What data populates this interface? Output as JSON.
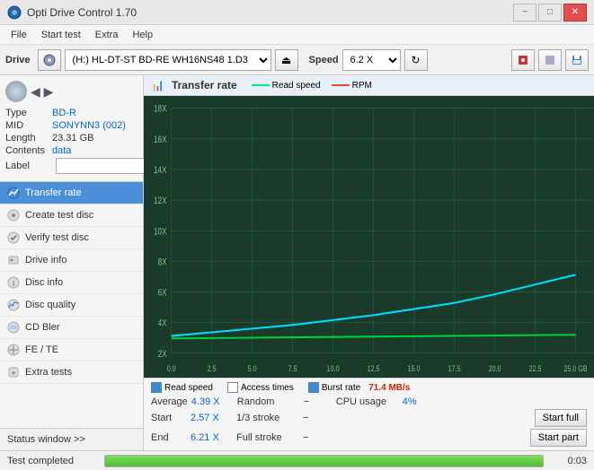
{
  "titleBar": {
    "title": "Opti Drive Control 1.70",
    "minimize": "−",
    "maximize": "□",
    "close": "✕"
  },
  "menu": {
    "items": [
      "File",
      "Start test",
      "Extra",
      "Help"
    ]
  },
  "driveToolbar": {
    "driveLabel": "Drive",
    "driveValue": "(H:)  HL-DT-ST BD-RE  WH16NS48 1.D3",
    "speedLabel": "Speed",
    "speedValue": "6.2 X"
  },
  "disc": {
    "typeLabel": "Type",
    "typeValue": "BD-R",
    "midLabel": "MID",
    "midValue": "SONYNN3 (002)",
    "lengthLabel": "Length",
    "lengthValue": "23.31 GB",
    "contentsLabel": "Contents",
    "contentsValue": "data",
    "labelLabel": "Label",
    "labelValue": ""
  },
  "nav": {
    "items": [
      {
        "id": "transfer-rate",
        "label": "Transfer rate",
        "active": true
      },
      {
        "id": "create-test-disc",
        "label": "Create test disc",
        "active": false
      },
      {
        "id": "verify-test-disc",
        "label": "Verify test disc",
        "active": false
      },
      {
        "id": "drive-info",
        "label": "Drive info",
        "active": false
      },
      {
        "id": "disc-info",
        "label": "Disc info",
        "active": false
      },
      {
        "id": "disc-quality",
        "label": "Disc quality",
        "active": false
      },
      {
        "id": "cd-bler",
        "label": "CD Bler",
        "active": false
      },
      {
        "id": "fe-te",
        "label": "FE / TE",
        "active": false
      },
      {
        "id": "extra-tests",
        "label": "Extra tests",
        "active": false
      }
    ],
    "statusWindow": "Status window >>"
  },
  "chart": {
    "title": "Transfer rate",
    "legend": {
      "readSpeedColor": "#00ee88",
      "rpmColor": "#ee4444",
      "readSpeedLabel": "Read speed",
      "rpmLabel": "RPM"
    },
    "yLabels": [
      "2X",
      "4X",
      "6X",
      "8X",
      "10X",
      "12X",
      "14X",
      "16X",
      "18X"
    ],
    "xLabels": [
      "0.0",
      "2.5",
      "5.0",
      "7.5",
      "10.0",
      "12.5",
      "15.0",
      "17.5",
      "20.0",
      "22.5",
      "25.0 GB"
    ],
    "readSpeedLineColor": "#00ddff",
    "rpmLineColor": "#00cc44"
  },
  "stats": {
    "checkboxes": [
      {
        "label": "Read speed",
        "checked": true
      },
      {
        "label": "Access times",
        "checked": false
      },
      {
        "label": "Burst rate",
        "checked": true
      }
    ],
    "burstRate": "71.4 MB/s",
    "rows": [
      {
        "label": "Average",
        "value": "4.39 X",
        "label2": "Random",
        "value2": "−",
        "label3": "CPU usage",
        "value3": "4%"
      },
      {
        "label": "Start",
        "value": "2.57 X",
        "label2": "1/3 stroke",
        "value2": "−",
        "btn": "Start full"
      },
      {
        "label": "End",
        "value": "6.21 X",
        "label2": "Full stroke",
        "value2": "−",
        "btn": "Start part"
      }
    ]
  },
  "statusBar": {
    "text": "Test completed",
    "progress": 100,
    "time": "0:03"
  }
}
